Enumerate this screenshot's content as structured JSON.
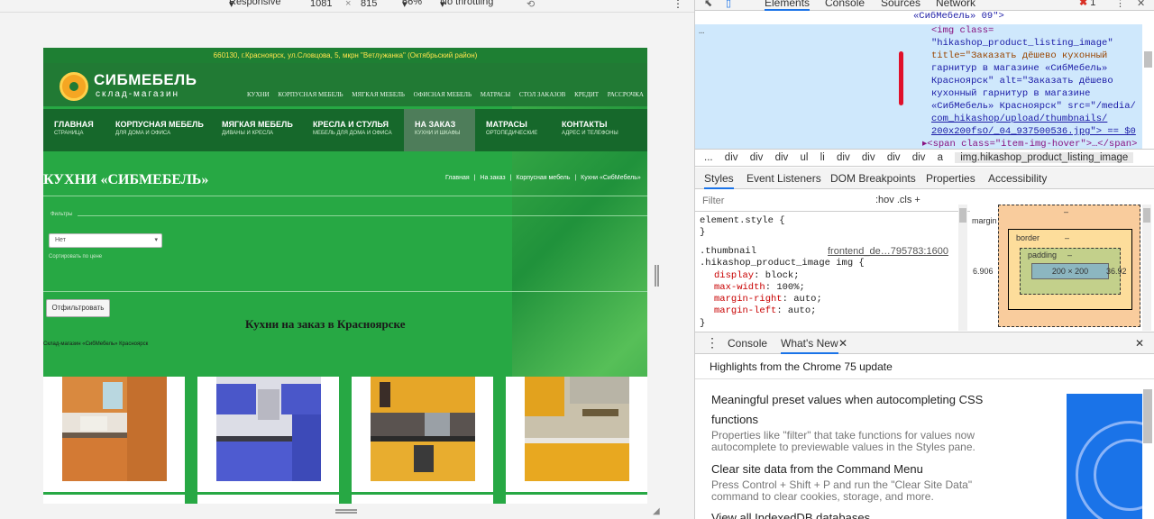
{
  "device_toolbar": {
    "device": "Responsive",
    "width": "1081",
    "x": "×",
    "height": "815",
    "zoom": "66%",
    "throttling": "No throttling"
  },
  "site": {
    "address_bar": "660130, г.Красноярск, ул.Словцова, 5, мкрн \"Ветлужанка\" (Октябрьский район)",
    "logo_title": "СИБМЕБЕЛЬ",
    "logo_subtitle": "склад-магазин",
    "top_menu": [
      "КУХНИ",
      "КОРПУСНАЯ МЕБЕЛЬ",
      "МЯГКАЯ МЕБЕЛЬ",
      "ОФИСНАЯ МЕБЕЛЬ",
      "МАТРАСЫ",
      "СТОЛ ЗАКАЗОВ",
      "КРЕДИТ",
      "РАССРОЧКА"
    ],
    "main_nav": [
      {
        "title": "ГЛАВНАЯ",
        "sub": "СТРАНИЦА"
      },
      {
        "title": "КОРПУСНАЯ МЕБЕЛЬ",
        "sub": "ДЛЯ ДОМА И ОФИСА"
      },
      {
        "title": "МЯГКАЯ МЕБЕЛЬ",
        "sub": "ДИВАНЫ И КРЕСЛА"
      },
      {
        "title": "КРЕСЛА И СТУЛЬЯ",
        "sub": "МЕБЕЛЬ ДЛЯ ДОМА И ОФИСА"
      },
      {
        "title": "НА ЗАКАЗ",
        "sub": "КУХНИ И ШКАФЫ"
      },
      {
        "title": "МАТРАСЫ",
        "sub": "ОРТОПЕДИЧЕСКИЕ"
      },
      {
        "title": "КОНТАКТЫ",
        "sub": "АДРЕС И ТЕЛЕФОНЫ"
      }
    ],
    "page_title": "КУХНИ «СИБМЕБЕЛЬ»",
    "breadcrumbs": [
      "Главная",
      "|",
      "На заказ",
      "|",
      "Корпусная мебель",
      "|",
      "Кухни «СибМебель»"
    ],
    "filters_legend": "Фильтры",
    "select_value": "Нет",
    "sort_label": "Сортировать по цене",
    "filter_button": "Отфильтровать",
    "section_title": "Кухни на заказ в Красноярске",
    "small_note": "Склад-магазин «СибМебель» Красноярск"
  },
  "devtools": {
    "tabs": [
      "Elements",
      "Console",
      "Sources",
      "Network"
    ],
    "active_tab": "Elements",
    "error_count": "1",
    "elements_top_line": "«СибМебель» 09\">",
    "img_lines": [
      "<img class=",
      "\"hikashop_product_listing_image\"",
      "title=\"Заказать дёшево кухонный",
      "гарнитур в магазине «СибМебель»",
      "Красноярск\" alt=\"Заказать дёшево",
      "кухонный гарнитур в магазине",
      "«СибМебель» Красноярск\" src=\"/media/",
      "com_hikashop/upload/thumbnails/",
      "200x200fsO/_04_937500536.jpg\"> == $0"
    ],
    "span_line": "▸<span class=\"item-img-hover\">…</span>",
    "crumb_path": [
      "...",
      "div",
      "div",
      "div",
      "ul",
      "li",
      "div",
      "div",
      "div",
      "div",
      "a"
    ],
    "crumb_current": "img.hikashop_product_listing_image",
    "style_tabs": [
      "Styles",
      "Event Listeners",
      "DOM Breakpoints",
      "Properties",
      "Accessibility"
    ],
    "filter_placeholder": "Filter",
    "filter_ops": ":hov  .cls  +",
    "element_style": "element.style {",
    "close_brace": "}",
    "rule_selector_1": ".thumbnail",
    "rule_selector_2": ".hikashop_product_image img {",
    "rule_source": "frontend_de…795783:1600",
    "declarations": [
      {
        "prop": "display",
        "val": "block;"
      },
      {
        "prop": "max-width",
        "val": "100%;"
      },
      {
        "prop": "margin-right",
        "val": "auto;"
      },
      {
        "prop": "margin-left",
        "val": "auto;"
      }
    ],
    "box_model": {
      "margin_label": "margin",
      "border_label": "border",
      "padding_label": "padding",
      "content": "200 × 200",
      "left_value": "6.906",
      "right_value": "36.92",
      "dash": "–"
    },
    "drawer_tabs": [
      "Console",
      "What's New"
    ],
    "highlights": "Highlights from the Chrome 75 update",
    "whats_new": [
      {
        "title": "Meaningful preset values when autocompleting CSS functions",
        "desc": "Properties like \"filter\" that take functions for values now autocomplete to previewable values in the Styles pane."
      },
      {
        "title": "Clear site data from the Command Menu",
        "desc": "Press Control + Shift + P and run the \"Clear Site Data\" command to clear cookies, storage, and more."
      },
      {
        "title": "View all IndexedDB databases",
        "desc": ""
      }
    ]
  }
}
